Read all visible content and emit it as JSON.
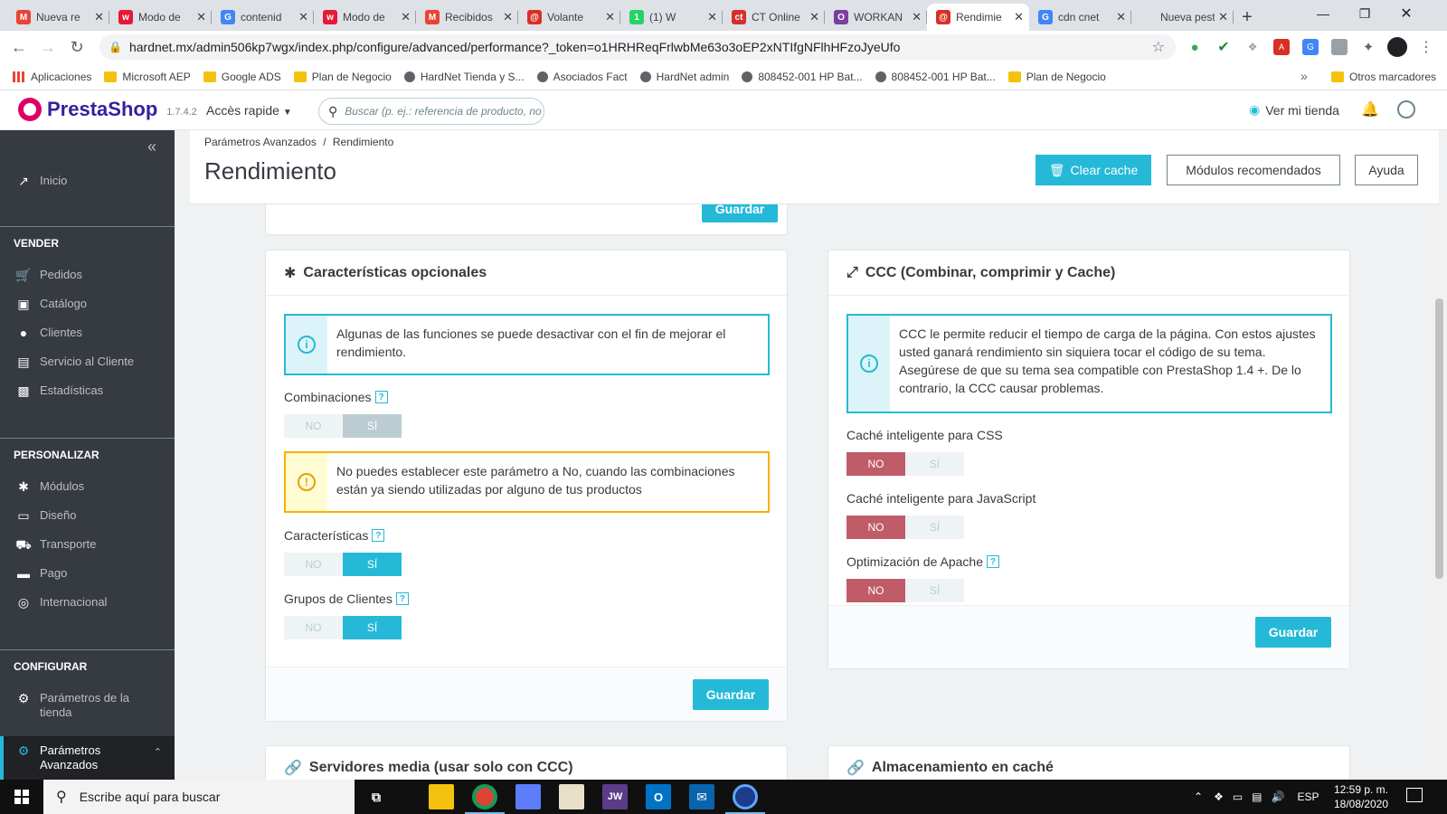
{
  "browser": {
    "tabs": [
      {
        "label": "Nueva re",
        "fav": "M",
        "color": "#ea4335"
      },
      {
        "label": "Modo de",
        "fav": "w",
        "color": "#e51937"
      },
      {
        "label": "contenid",
        "fav": "G",
        "color": "#4285f4"
      },
      {
        "label": "Modo de",
        "fav": "w",
        "color": "#e51937"
      },
      {
        "label": "Recibidos",
        "fav": "M",
        "color": "#ea4335"
      },
      {
        "label": "Volante",
        "fav": "@",
        "color": "#d93025"
      },
      {
        "label": "(1) W",
        "fav": "1",
        "color": "#25d366"
      },
      {
        "label": "CT Online",
        "fav": "ct",
        "color": "#d32f2f"
      },
      {
        "label": "WORKAN",
        "fav": "O",
        "color": "#7b3fa0"
      },
      {
        "label": "Rendimie",
        "fav": "@",
        "color": "#d93025",
        "active": true
      },
      {
        "label": "cdn cnet",
        "fav": "G",
        "color": "#4285f4"
      },
      {
        "label": "Nueva pestañ",
        "fav": "",
        "color": "#dee1e6"
      }
    ],
    "url": "hardnet.mx/admin506kp7wgx/index.php/configure/advanced/performance?_token=o1HRHReqFrlwbMe63o3oEP2xNTIfgNFlhHFzoJyeUfo",
    "bookmarks": [
      {
        "label": "Aplicaciones",
        "type": "apps"
      },
      {
        "label": "Microsoft AEP",
        "type": "folder"
      },
      {
        "label": "Google ADS",
        "type": "folder"
      },
      {
        "label": "Plan de Negocio",
        "type": "folder"
      },
      {
        "label": "HardNet Tienda y S...",
        "type": "site"
      },
      {
        "label": "Asociados Fact",
        "type": "site"
      },
      {
        "label": "HardNet admin",
        "type": "site"
      },
      {
        "label": "808452-001 HP Bat...",
        "type": "site"
      },
      {
        "label": "808452-001 HP Bat...",
        "type": "site"
      },
      {
        "label": "Plan de Negocio",
        "type": "folder"
      }
    ],
    "bookmarks_more": "»",
    "other_bookmarks": "Otros marcadores"
  },
  "header": {
    "brand": "PrestaShop",
    "version": "1.7.4.2",
    "quick_access": "Accès rapide",
    "search_placeholder": "Buscar (p. ej.: referencia de producto, no",
    "view_shop": "Ver mi tienda"
  },
  "sidebar": {
    "top_item": {
      "label": "Inicio",
      "icon": "trending-icon"
    },
    "sections": [
      {
        "title": "VENDER",
        "items": [
          {
            "label": "Pedidos",
            "icon": "basket-icon"
          },
          {
            "label": "Catálogo",
            "icon": "store-icon"
          },
          {
            "label": "Clientes",
            "icon": "user-icon"
          },
          {
            "label": "Servicio al Cliente",
            "icon": "chat-icon"
          },
          {
            "label": "Estadísticas",
            "icon": "chart-icon"
          }
        ]
      },
      {
        "title": "PERSONALIZAR",
        "items": [
          {
            "label": "Módulos",
            "icon": "puzzle-icon"
          },
          {
            "label": "Diseño",
            "icon": "monitor-icon"
          },
          {
            "label": "Transporte",
            "icon": "truck-icon"
          },
          {
            "label": "Pago",
            "icon": "card-icon"
          },
          {
            "label": "Internacional",
            "icon": "globe-icon"
          }
        ]
      },
      {
        "title": "CONFIGURAR",
        "items": [
          {
            "label": "Parámetros de la tienda",
            "icon": "gear-icon"
          },
          {
            "label": "Parámetros Avanzados",
            "icon": "settings-icon",
            "active": true
          }
        ]
      }
    ]
  },
  "page": {
    "breadcrumb": [
      "Parámetros Avanzados",
      "Rendimiento"
    ],
    "title": "Rendimiento",
    "buttons": {
      "clear_cache": "Clear cache",
      "recommended": "Módulos recomendados",
      "help": "Ayuda"
    }
  },
  "panels": {
    "save_label": "Guardar",
    "optional": {
      "title": "Características opcionales",
      "info": "Algunas de las funciones se puede desactivar con el fin de mejorar el rendimiento.",
      "warning": "No puedes establecer este parámetro a No, cuando las combinaciones están ya siendo utilizadas por alguno de tus productos",
      "fields": [
        {
          "label": "Combinaciones",
          "value": "SÍ",
          "state": "disabled"
        },
        {
          "label": "Características",
          "value": "SÍ",
          "state": "on"
        },
        {
          "label": "Grupos de Clientes",
          "value": "SÍ",
          "state": "on"
        }
      ]
    },
    "ccc": {
      "title": "CCC (Combinar, comprimir y Cache)",
      "info": "CCC le permite reducir el tiempo de carga de la página. Con estos ajustes usted ganará rendimiento sin siquiera tocar el código de su tema. Asegúrese de que su tema sea compatible con PrestaShop 1.4 +. De lo contrario, la CCC causar problemas.",
      "fields": [
        {
          "label": "Caché inteligente para CSS",
          "value": "NO",
          "help": false
        },
        {
          "label": "Caché inteligente para JavaScript",
          "value": "NO",
          "help": false
        },
        {
          "label": "Optimización de Apache",
          "value": "NO",
          "help": true
        }
      ]
    },
    "media": {
      "title": "Servidores media (usar solo con CCC)"
    },
    "cache": {
      "title": "Almacenamiento en caché"
    },
    "switch_no": "NO",
    "switch_yes": "SÍ",
    "help_mark": "?"
  },
  "taskbar": {
    "search_placeholder": "Escribe aquí para buscar",
    "language": "ESP",
    "time": "12:59 p. m.",
    "date": "18/08/2020"
  },
  "colors": {
    "accent": "#25b9d7",
    "danger": "#c05c67",
    "warning": "#fab000",
    "sidebar": "#363a41"
  }
}
